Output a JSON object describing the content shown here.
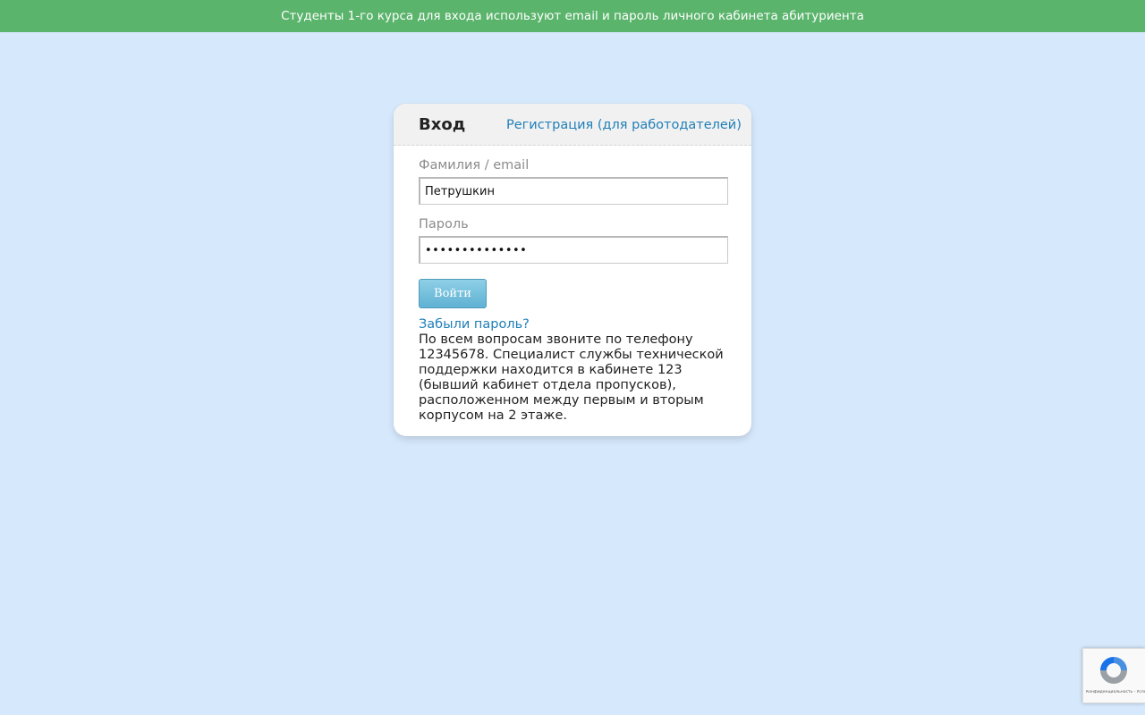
{
  "notice": {
    "text": "Студенты 1-го курса для входа используют email и пароль личного кабинета абитуриента"
  },
  "login_card": {
    "title": "Вход",
    "register_link": "Регистрация (для работодателей)",
    "login_label": "Фамилия / email",
    "login_value": "Петрушкин",
    "password_label": "Пароль",
    "password_value": "••••••••••••••",
    "submit_label": "Войти",
    "forgot_link": "Забыли пароль?",
    "support_text": "По всем вопросам звоните по телефону 12345678. Специалист службы технической поддержки находится в кабинете 123 (бывший кабинет отдела пропусков), расположенном между первым и вторым корпусом на 2 этаже."
  },
  "recaptcha": {
    "terms": "Конфиденциальность - Условия использования",
    "icon": "recaptcha-icon"
  },
  "colors": {
    "background": "#d6e8fc",
    "notice_bar": "#5bb46c",
    "link": "#1f7fb8",
    "button": "#6fbcdc"
  }
}
